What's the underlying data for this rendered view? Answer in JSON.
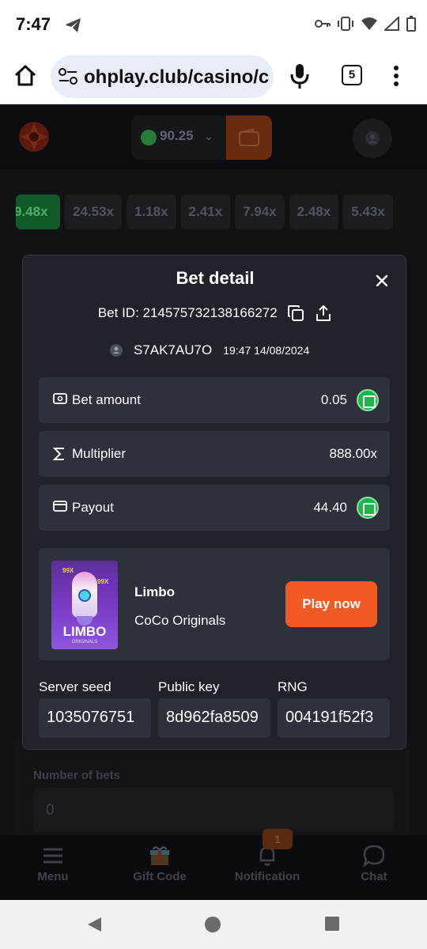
{
  "status_bar": {
    "time": "7:47"
  },
  "browser": {
    "url": "ohplay.club/casino/c",
    "tab_count": "5"
  },
  "header": {
    "balance": "90.25"
  },
  "multipliers": [
    "9.48x",
    "24.53x",
    "1.18x",
    "2.41x",
    "7.94x",
    "2.48x",
    "5.43x"
  ],
  "background_form": {
    "number_of_bets_label": "Number of bets",
    "number_of_bets_value": "0"
  },
  "bottom_nav": {
    "menu": "Menu",
    "gift_code": "Gift Code",
    "notification": "Notification",
    "notification_badge": "1",
    "chat": "Chat"
  },
  "modal": {
    "title": "Bet detail",
    "bet_id": "Bet ID: 214575732138166272",
    "username": "S7AK7AU7O",
    "datetime": "19:47 14/08/2024",
    "bet_amount_label": "Bet amount",
    "bet_amount_value": "0.05",
    "multiplier_label": "Multiplier",
    "multiplier_value": "888.00x",
    "payout_label": "Payout",
    "payout_value": "44.40",
    "game": {
      "thumb_title": "LIMBO",
      "thumb_subtitle": "ORIGINALS",
      "thumb_tag": "99X",
      "name": "Limbo",
      "provider": "CoCo Originals",
      "play_label": "Play now"
    },
    "server_seed_label": "Server seed",
    "server_seed_value": "1035076751",
    "public_key_label": "Public key",
    "public_key_value": "8d962fa8509",
    "rng_label": "RNG",
    "rng_value": "004191f52f3"
  },
  "colors": {
    "accent_orange": "#f15a24",
    "coin_green": "#1fb54a",
    "chat_green": "#3fb553",
    "modal_bg": "#20232a",
    "card_bg": "#2d313a"
  }
}
